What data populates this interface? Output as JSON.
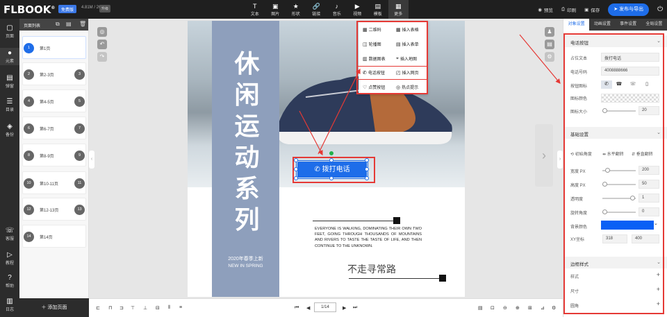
{
  "app": {
    "logo": "FLBOOK",
    "plan": "免费版",
    "quota": "4.81M / 200M",
    "badge": "升级"
  },
  "toolbar": {
    "tools": [
      {
        "label": "文本",
        "icon": "T"
      },
      {
        "label": "图片",
        "icon": "▣"
      },
      {
        "label": "形状",
        "icon": "★"
      },
      {
        "label": "链接",
        "icon": "🔗"
      },
      {
        "label": "音乐",
        "icon": "♪"
      },
      {
        "label": "视频",
        "icon": "▶"
      },
      {
        "label": "模板",
        "icon": "▤"
      },
      {
        "label": "更多",
        "icon": "▦"
      }
    ],
    "preview": "预览",
    "print": "印刷",
    "save": "保存",
    "publish": "发布与导出"
  },
  "leftnav": [
    {
      "label": "页面",
      "icon": "▢"
    },
    {
      "label": "元素",
      "icon": "●"
    },
    {
      "label": "弹窗",
      "icon": "▤"
    },
    {
      "label": "目录",
      "icon": "☰"
    },
    {
      "label": "备份",
      "icon": "◈"
    },
    {
      "label": "客服",
      "icon": "☏"
    },
    {
      "label": "教程",
      "icon": "▷"
    },
    {
      "label": "帮助",
      "icon": "?"
    },
    {
      "label": "日志",
      "icon": "▥"
    }
  ],
  "pages": {
    "title": "页面列表",
    "add": "添加页面",
    "items": [
      {
        "n": "1",
        "label": "第1页",
        "n2": ""
      },
      {
        "n": "2",
        "label": "第2-3页",
        "n2": "3"
      },
      {
        "n": "4",
        "label": "第4-5页",
        "n2": "5"
      },
      {
        "n": "6",
        "label": "第6-7页",
        "n2": "7"
      },
      {
        "n": "8",
        "label": "第8-9页",
        "n2": "9"
      },
      {
        "n": "10",
        "label": "第10-11页",
        "n2": "11"
      },
      {
        "n": "12",
        "label": "第12-13页",
        "n2": "13"
      },
      {
        "n": "14",
        "label": "第14页",
        "n2": ""
      }
    ]
  },
  "page": {
    "title": "休闲运动系列",
    "spring_cn": "2020年春季上新",
    "spring_en": "NEW IN SPRING",
    "paragraph": "EVERYONE IS WALKING, DOMINATING THEIR OWN TWO FEET, GOING THROUGH THOUSANDS OF MOUNTAINS AND RIVERS TO TASTE THE TASTE OF LIFE, AND THEN CONTINUE TO THE UNKNOWN.",
    "slogan": "不走寻常路",
    "call_button": "拨打电话"
  },
  "more_menu": [
    {
      "label": "二维码",
      "icon": "▦"
    },
    {
      "label": "插入表格",
      "icon": "▦"
    },
    {
      "label": "轮播图",
      "icon": "◫"
    },
    {
      "label": "插入表单",
      "icon": "▤"
    },
    {
      "label": "数据图表",
      "icon": "▥"
    },
    {
      "label": "插入地图",
      "icon": "⌖"
    },
    {
      "label": "电话按钮",
      "icon": "✆"
    },
    {
      "label": "插入网页",
      "icon": "◰"
    },
    {
      "label": "点赞按钮",
      "icon": "♡"
    },
    {
      "label": "热点提示",
      "icon": "◎"
    }
  ],
  "pager": "1/14",
  "props": {
    "tabs": [
      "对象设置",
      "动画设置",
      "事件设置",
      "全局设置"
    ],
    "sec1": "电话按钮",
    "text_label": "占位文本",
    "text_value": "拨打电话",
    "phone_label": "电话号码",
    "phone_value": "4008888666",
    "icon_label": "按钮图标",
    "icolor_label": "图标颜色",
    "isize_label": "图标大小",
    "isize_value": "20",
    "sec2": "基础设置",
    "flip_init": "初始角度",
    "flip_h": "水平翻转",
    "flip_v": "垂直翻转",
    "w_label": "宽度 PX",
    "w_value": "200",
    "h_label": "高度 PX",
    "h_value": "50",
    "op_label": "透明度",
    "op_value": "1",
    "rot_label": "旋转角度",
    "rot_value": "0",
    "bg_label": "背景颜色",
    "bg_color": "#0a60f5",
    "xy_label": "XY坐标",
    "x_value": "318",
    "y_value": "400",
    "sec3": "边框样式",
    "style_label": "样式",
    "size_label": "尺寸",
    "radius_label": "圆角"
  }
}
